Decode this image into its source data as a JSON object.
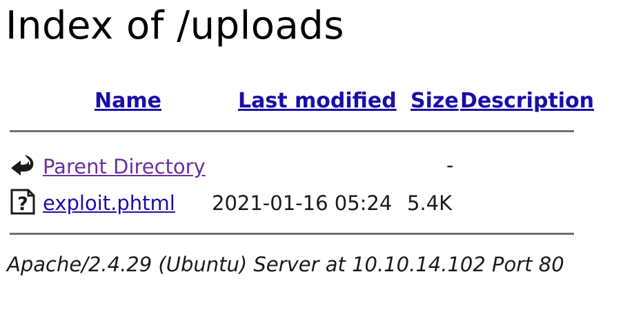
{
  "page": {
    "title": "Index of /uploads"
  },
  "table": {
    "headers": {
      "name": "Name",
      "last_modified": "Last modified",
      "size": "Size",
      "description": "Description"
    },
    "rows": [
      {
        "icon": "back-icon",
        "name": "Parent Directory",
        "last_modified": "",
        "size": "-",
        "description": "",
        "visited": true
      },
      {
        "icon": "unknown-file-icon",
        "name": "exploit.phtml",
        "last_modified": "2021-01-16 05:24",
        "size": "5.4K",
        "description": "",
        "visited": false
      }
    ]
  },
  "footer": {
    "server_signature": "Apache/2.4.29 (Ubuntu) Server at 10.10.14.102 Port 80"
  },
  "colors": {
    "link": "#1a0dab",
    "visited_link": "#6a2f9e",
    "rule": "#6f6f6f"
  }
}
